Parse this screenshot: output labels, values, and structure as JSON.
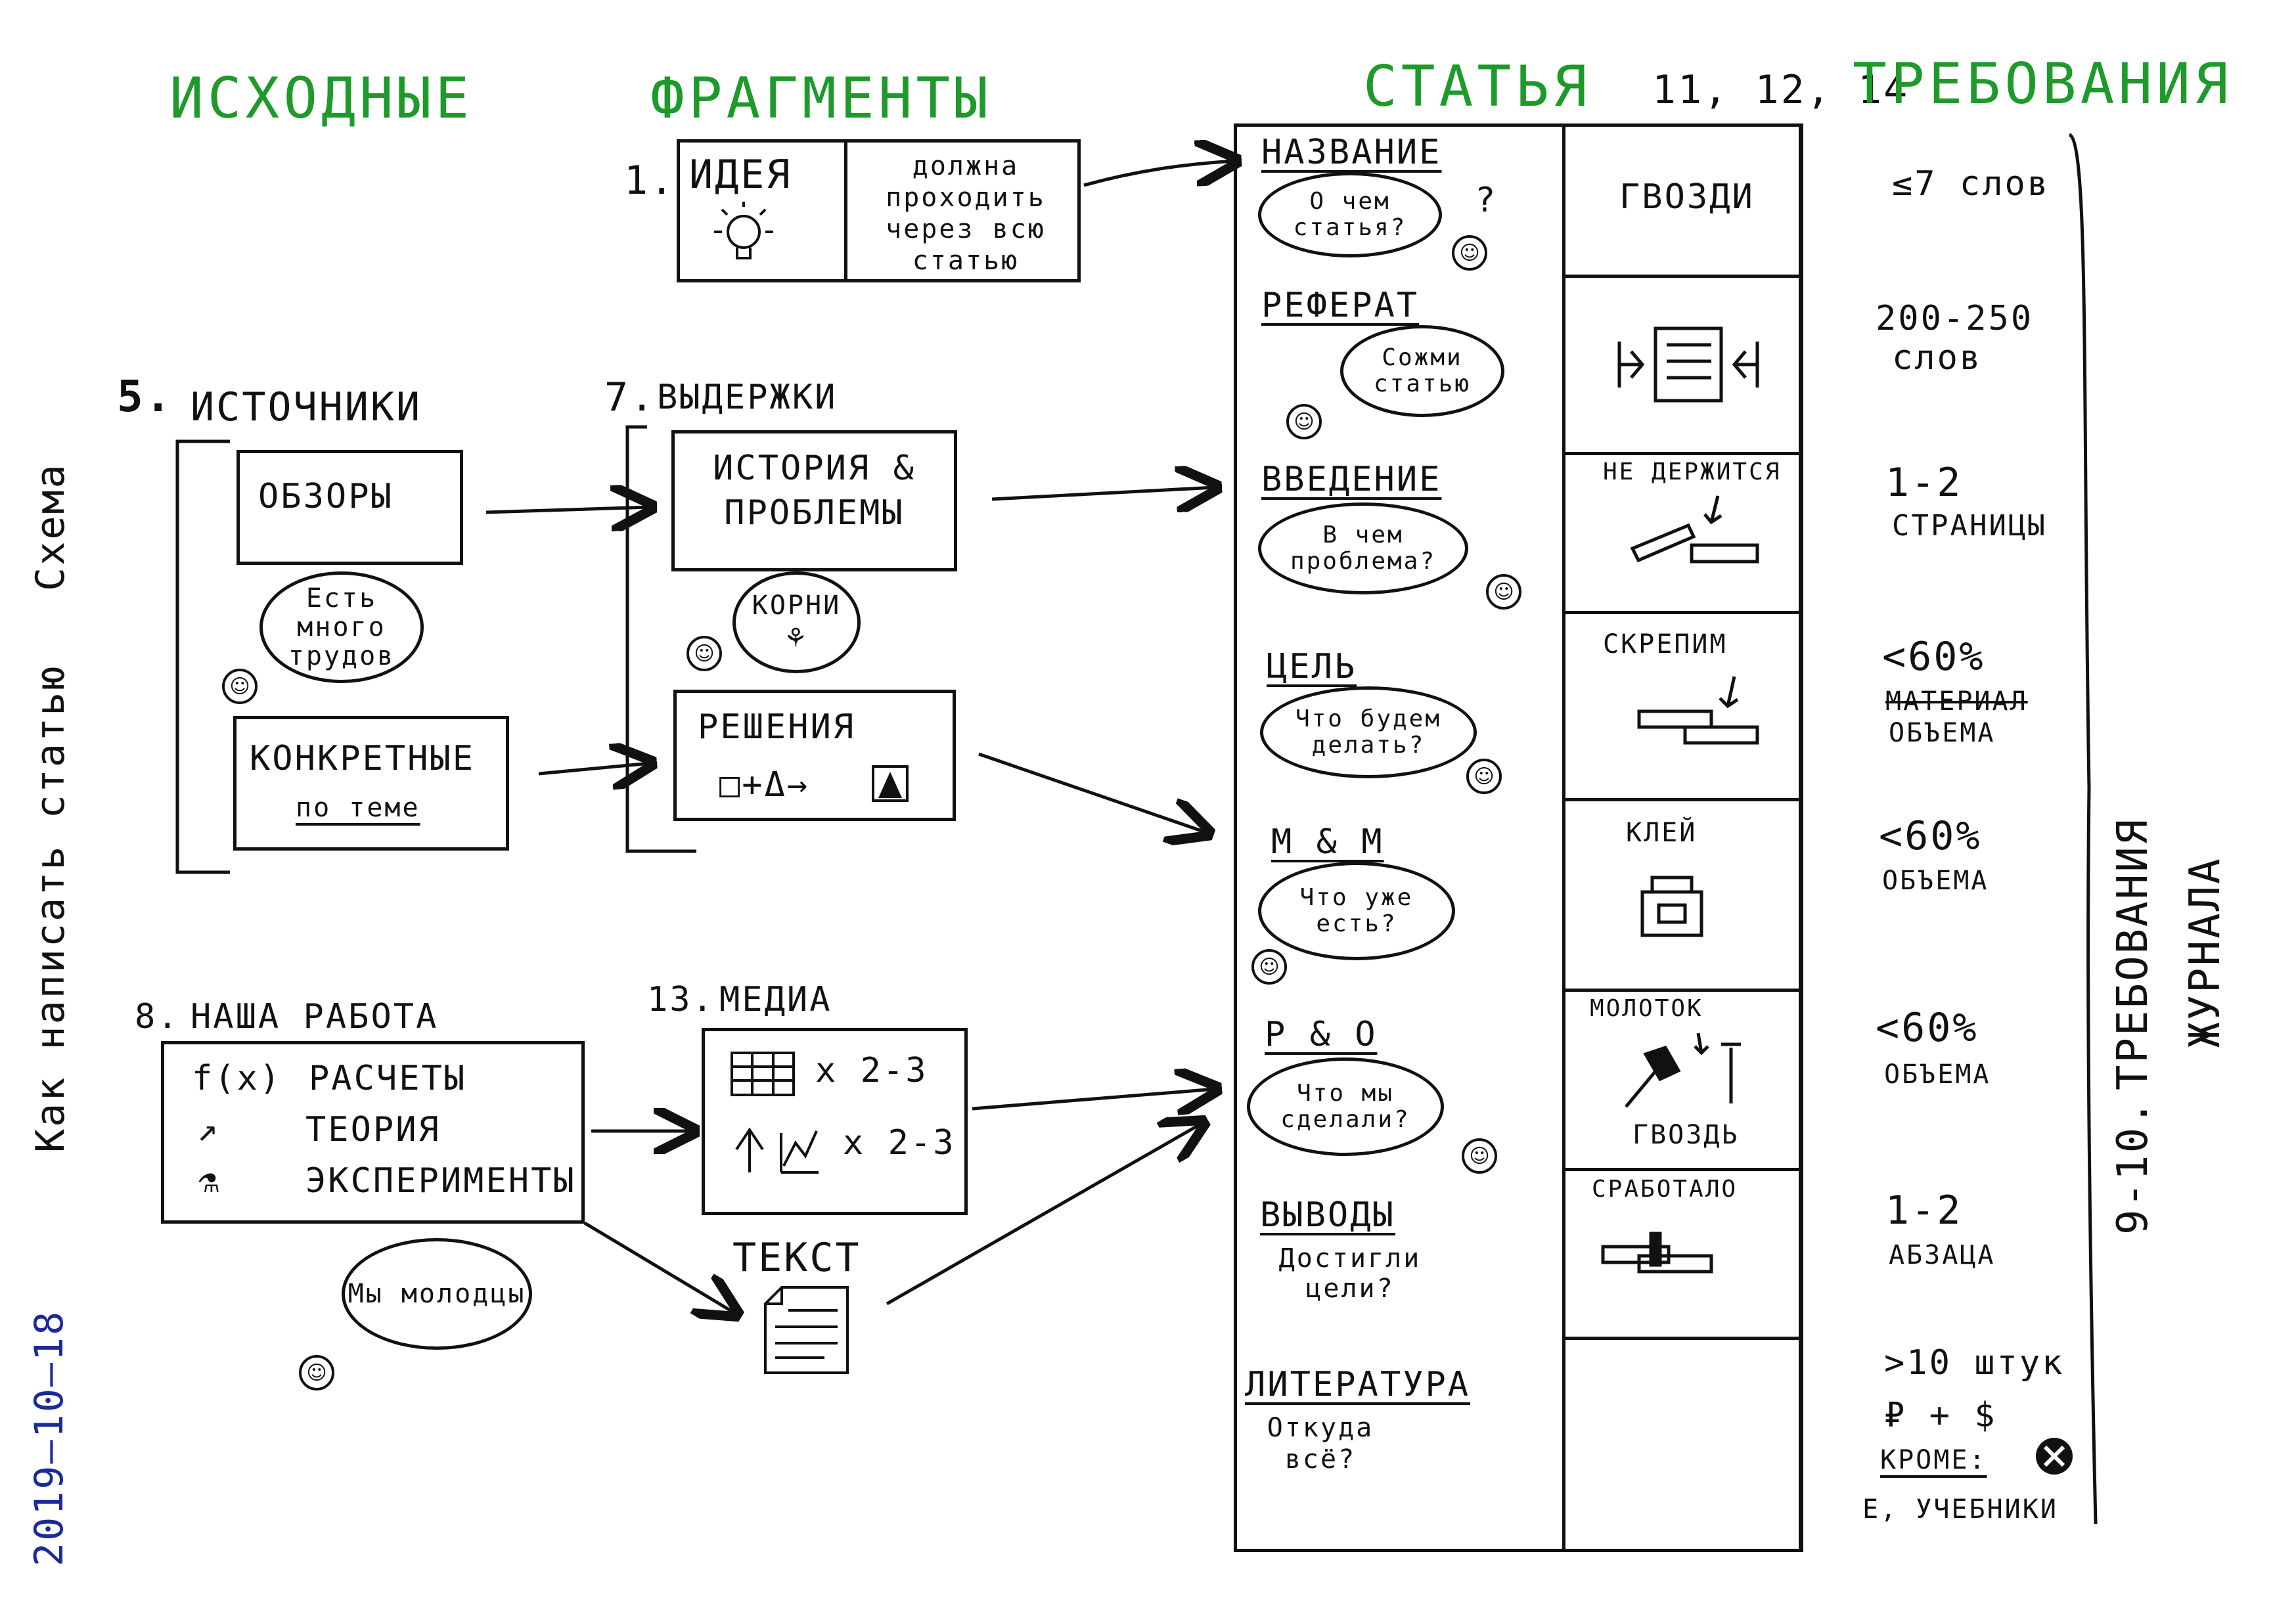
{
  "headers": {
    "source": "ИСХОДНЫЕ",
    "fragments": "ФРАГМЕНТЫ",
    "article": "СТАТЬЯ",
    "nums": "11, 12, 14",
    "requirements": "ТРЕБОВАНИЯ"
  },
  "margin": {
    "date": "2019—10—18",
    "title": "Как написать статью",
    "scheme": "Схема"
  },
  "idea": {
    "num": "1.",
    "label": "ИДЕЯ",
    "text": "должна проходить через всю статью"
  },
  "sources": {
    "num": "5.",
    "label": "ИСТОЧНИКИ",
    "reviews": "ОБЗОРЫ",
    "bubble": "Есть много трудов",
    "specific": "КОНКРЕТНЫЕ",
    "specific_sub": "по теме"
  },
  "excerpts": {
    "num": "7.",
    "label": "ВЫДЕРЖКИ",
    "history": "ИСТОРИЯ & ПРОБЛЕМЫ",
    "roots": "КОРНИ",
    "solutions": "РЕШЕНИЯ",
    "formula": "□+Δ→"
  },
  "our_work": {
    "num": "8.",
    "label": "НАША РАБОТА",
    "items": [
      {
        "icon": "f(x)",
        "text": "РАСЧЕТЫ"
      },
      {
        "icon": "↗",
        "text": "ТЕОРИЯ"
      },
      {
        "icon": "⚗",
        "text": "ЭКСПЕРИМЕНТЫ"
      }
    ],
    "bubble": "Мы молодцы"
  },
  "media": {
    "num": "13.",
    "label": "МЕДИА",
    "row1": "x 2-3",
    "row2": "x 2-3",
    "text_label": "ТЕКСТ"
  },
  "article_sections": [
    {
      "title": "НАЗВАНИЕ",
      "bubble": "О чем статья?",
      "extra": "?"
    },
    {
      "title": "РЕФЕРАТ",
      "bubble": "Сожми статью"
    },
    {
      "title": "ВВЕДЕНИЕ",
      "bubble": "В чем проблема?"
    },
    {
      "title": "ЦЕЛЬ",
      "bubble": "Что будем делать?"
    },
    {
      "title": "М & М",
      "bubble": "Что уже есть?"
    },
    {
      "title": "Р & О",
      "bubble": "Что мы сделали?"
    },
    {
      "title": "ВЫВОДЫ",
      "bubble": "Достигли цели?"
    },
    {
      "title": "ЛИТЕРАТУРА",
      "bubble": "Откуда всё?"
    }
  ],
  "metaphors": [
    {
      "label": "ГВОЗДИ"
    },
    {
      "label": ""
    },
    {
      "label": "НЕ ДЕРЖИТСЯ"
    },
    {
      "label": "СКРЕПИМ"
    },
    {
      "label": "КЛЕЙ"
    },
    {
      "label": "МОЛОТОК",
      "sub": "ГВОЗДЬ"
    },
    {
      "label": "СРАБОТАЛО"
    },
    {
      "label": ""
    }
  ],
  "limits": [
    {
      "line1": "≤7 слов"
    },
    {
      "line1": "200-250",
      "line2": "слов"
    },
    {
      "line1": "1-2",
      "line2": "СТРАНИЦЫ"
    },
    {
      "line1": "<60%",
      "strike": "МАТЕРИАЛ",
      "line2": "ОБЪЕМА"
    },
    {
      "line1": "<60%",
      "line2": "ОБЪЕМА"
    },
    {
      "line1": "<60%",
      "line2": "ОБЪЕМА"
    },
    {
      "line1": "1-2",
      "line2": "АБЗАЦА"
    },
    {
      "line1": ">10 штук",
      "line2": "₽ + $",
      "line3": "КРОМЕ:",
      "line4": "Е, УЧЕБНИКИ"
    }
  ],
  "journal": {
    "num": "9-10.",
    "line1": "ТРЕБОВАНИЯ",
    "line2": "ЖУРНАЛА"
  }
}
